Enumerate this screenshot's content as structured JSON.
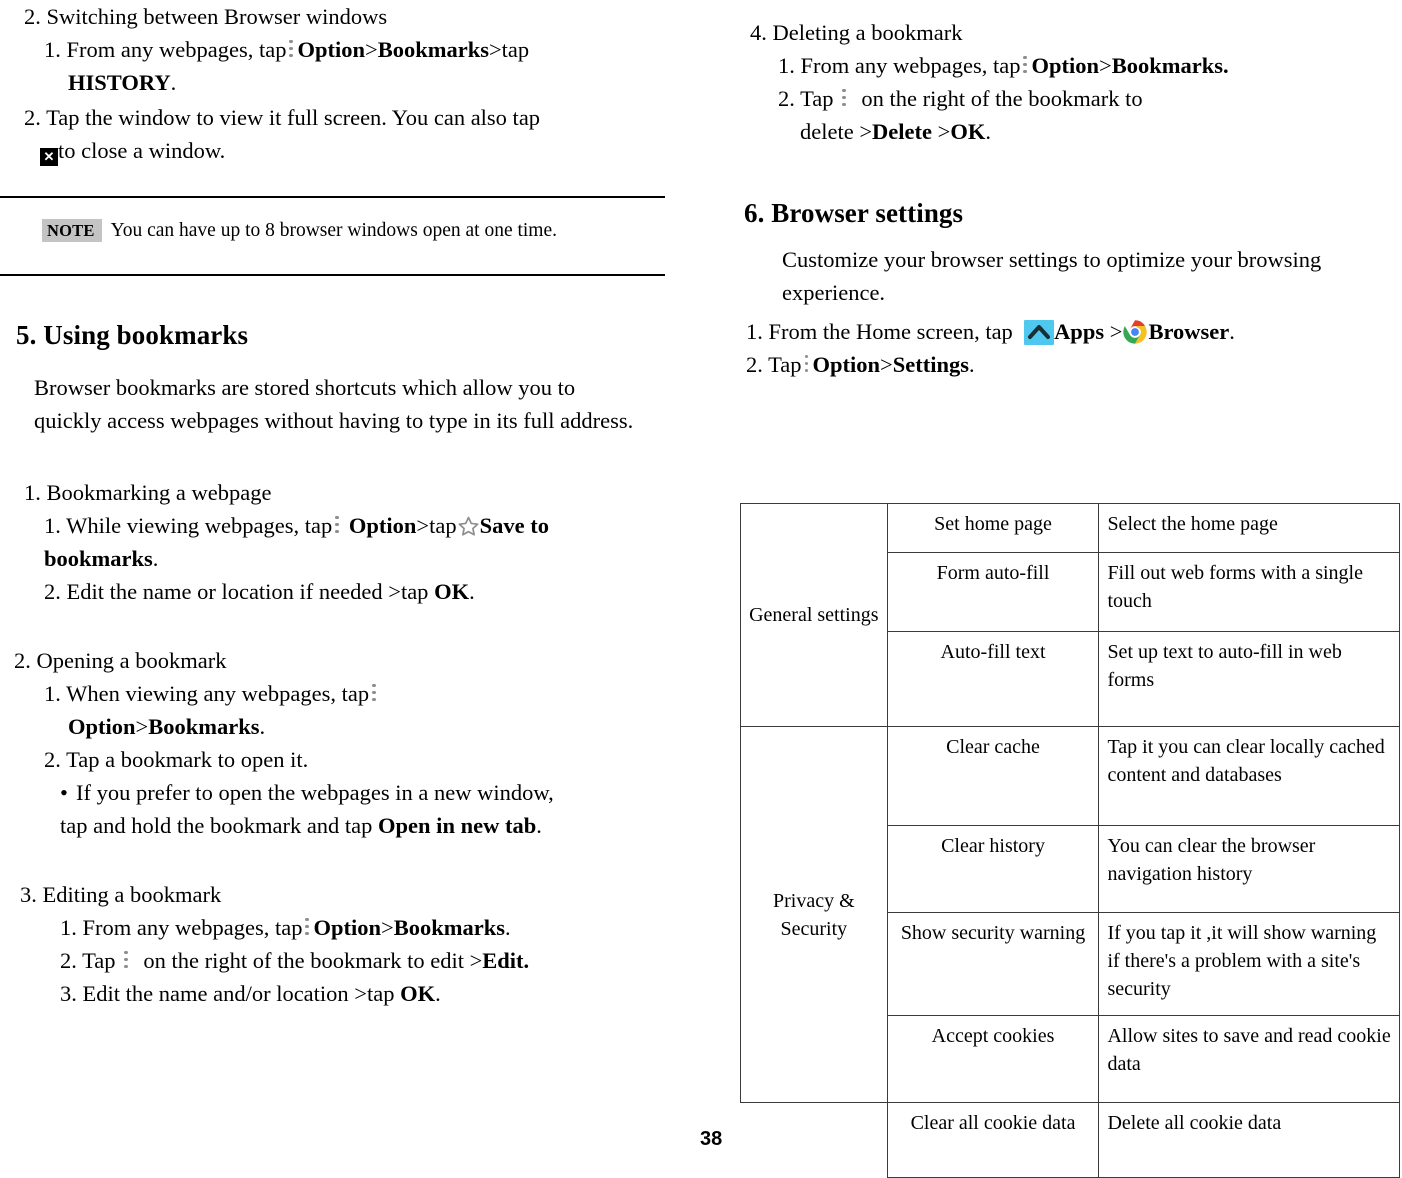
{
  "page": {
    "number": "38"
  },
  "left_column": {
    "section_switching": {
      "heading": "2. Switching between Browser windows",
      "step1_a": "1. From any webpages, tap",
      "step1_b": "Option",
      "step1_c": ">",
      "step1_d": "Bookmarks",
      "step1_e": ">tap",
      "step1_f": "HISTORY",
      "step1_g": ".",
      "step2_a": "2. Tap the window to view it full screen. You can also tap",
      "step2_b": "to close a window."
    },
    "note": {
      "tag": "NOTE",
      "text": "You can have up to 8 browser windows open at one time."
    },
    "section_bookmarks": {
      "heading": "5. Using bookmarks",
      "intro": "Browser bookmarks are stored shortcuts which allow you to quickly access webpages without having to type in its full address.",
      "sub1": {
        "heading": "1. Bookmarking a webpage",
        "step1_a": "1. While viewing webpages, tap",
        "step1_b": "Option",
        "step1_c": ">tap",
        "step1_d": "Save to bookmarks",
        "step1_e": ".",
        "step2_a": "2. Edit the name or location if needed >tap",
        "step2_b": "OK",
        "step2_c": "."
      },
      "sub2": {
        "heading": "2. Opening a bookmark",
        "step1_a": "1. When viewing any webpages, tap",
        "step1_b": "Option",
        "step1_c": ">",
        "step1_d": "Bookmarks",
        "step1_e": ".",
        "step2": "2. Tap a bookmark to open it.",
        "bullet_a": "If you prefer to open the webpages in a new window, tap and hold the bookmark and tap",
        "bullet_b": "Open in new tab",
        "bullet_c": "."
      },
      "sub3": {
        "heading": "3. Editing a bookmark",
        "step1_a": "1. From any webpages, tap",
        "step1_b": "Option",
        "step1_c": ">",
        "step1_d": "Bookmarks",
        "step1_e": ".",
        "step2_a": "2. Tap",
        "step2_b": "on the right of the bookmark to edit >",
        "step2_c": "Edit.",
        "step3_a": "3. Edit the name and/or location >tap",
        "step3_b": "OK",
        "step3_c": "."
      }
    }
  },
  "right_column": {
    "sub4": {
      "heading": "4. Deleting a bookmark",
      "step1_a": "1. From any webpages, tap",
      "step1_b": "Option",
      "step1_c": ">",
      "step1_d": "Bookmarks.",
      "step2_a": "2. Tap",
      "step2_b": "on the right of the bookmark to",
      "step2_c": "delete >",
      "step2_d": "Delete",
      "step2_e": ">",
      "step2_f": "OK",
      "step2_g": "."
    },
    "section_settings": {
      "heading": "6. Browser settings",
      "intro": "Customize your browser settings to optimize your browsing experience.",
      "step1_a": "1. From the Home screen, tap",
      "step1_b": "Apps",
      "step1_c": ">",
      "step1_d": "Browser",
      "step1_e": ".",
      "step2_a": "2. Tap",
      "step2_b": "Option",
      "step2_c": ">",
      "step2_d": "Settings",
      "step2_e": "."
    },
    "settings_table": {
      "groups": [
        {
          "name": "General settings",
          "rows": [
            {
              "setting": "Set home page",
              "description": "Select the home page"
            },
            {
              "setting": "Form auto-fill",
              "description": "Fill out web forms with a single touch"
            },
            {
              "setting": "Auto-fill text",
              "description": "Set up text to auto-fill in web forms"
            }
          ]
        },
        {
          "name": "Privacy & Security",
          "rows": [
            {
              "setting": "Clear cache",
              "description": "Tap it you can clear locally cached content and databases"
            },
            {
              "setting": "Clear history",
              "description": "You can clear the browser navigation history"
            },
            {
              "setting": "Show security warning",
              "description": "If you tap it ,it will show warning if there's a problem with a site's security"
            },
            {
              "setting": "Accept cookies",
              "description": "Allow sites to save and read cookie data"
            }
          ]
        },
        {
          "name": "",
          "rows": [
            {
              "setting": "Clear all cookie data",
              "description": "Delete all cookie data"
            }
          ]
        }
      ]
    }
  },
  "icons": {
    "option_menu": "three-dots-vertical-icon",
    "close_window": "close-x-icon",
    "save_bookmark": "star-outline-icon",
    "apps": "apps-chevron-up-icon",
    "browser": "chrome-browser-icon"
  },
  "colors": {
    "apps_icon_bg": "#4ec8ef",
    "note_tag_bg": "#c4c4c4",
    "dots_gray": "#8e8e8e",
    "chrome_red": "#e2402b",
    "chrome_yellow": "#f6c125",
    "chrome_green": "#35a853",
    "chrome_blue": "#4486f4"
  }
}
